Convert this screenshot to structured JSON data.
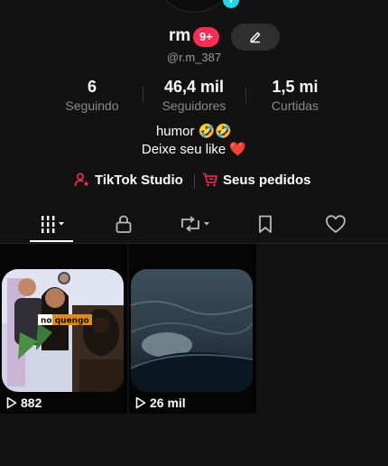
{
  "profile": {
    "username": "rm",
    "notification_badge": "9+",
    "handle": "@r.m_387"
  },
  "stats": [
    {
      "value": "6",
      "label": "Seguindo"
    },
    {
      "value": "46,4 mil",
      "label": "Seguidores"
    },
    {
      "value": "1,5 mi",
      "label": "Curtidas"
    }
  ],
  "bio": {
    "line1": "humor 🤣🤣",
    "line2": "Deixe seu like ❤️"
  },
  "tools": {
    "studio_label": "TikTok Studio",
    "orders_label": "Seus pedidos"
  },
  "tabs": [
    {
      "icon": "grid-icon",
      "selected": true
    },
    {
      "icon": "lock-icon"
    },
    {
      "icon": "repost-icon"
    },
    {
      "icon": "bookmark-icon"
    },
    {
      "icon": "heart-icon"
    }
  ],
  "videos": [
    {
      "views": "882",
      "overlay_text": "no quengo"
    },
    {
      "views": "26 mil"
    }
  ],
  "colors": {
    "background": "#121212",
    "badge": "#fe2c55",
    "accent_blue": "#20d5ec",
    "muted_text": "#8a8a8a"
  }
}
